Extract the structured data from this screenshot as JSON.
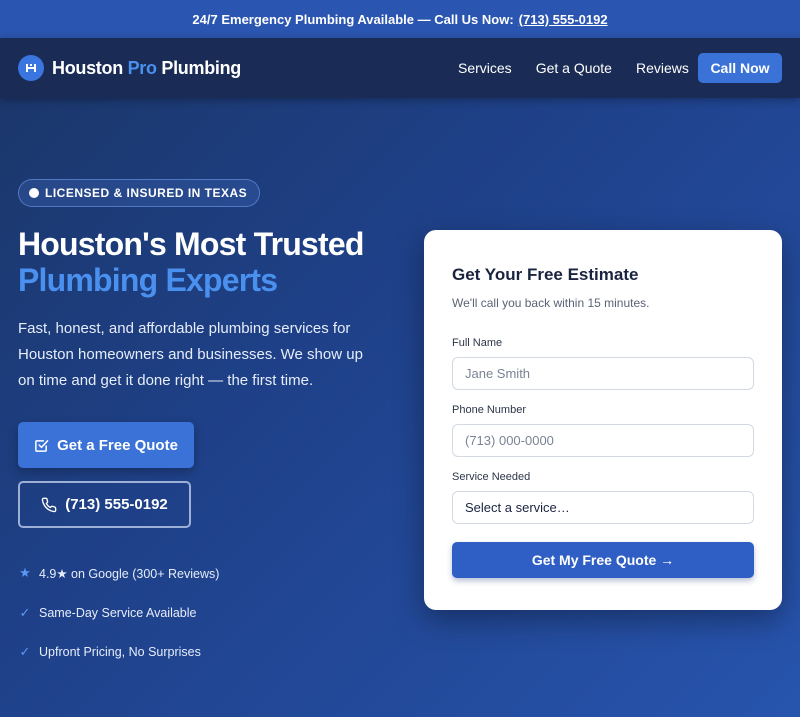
{
  "topbar": {
    "text": "24/7 Emergency Plumbing Available — Call Us Now:",
    "phone": "(713) 555-0192"
  },
  "brand": {
    "part1": "Houston ",
    "part2": "Pro",
    "part3": " Plumbing"
  },
  "nav": {
    "items": [
      "Services",
      "Get a Quote",
      "Reviews"
    ],
    "cta": "Call Now"
  },
  "hero": {
    "badge": "LICENSED & INSURED IN TEXAS",
    "headline_1": "Houston's Most Trusted",
    "headline_2": "Plumbing Experts",
    "lead": "Fast, honest, and affordable plumbing services for Houston homeowners and businesses. We show up on time and get it done right — the first time.",
    "btn_quote": "Get a Free Quote",
    "btn_phone": "(713) 555-0192",
    "features": [
      {
        "icon": "star-icon",
        "text": "4.9★ on Google (300+ Reviews)"
      },
      {
        "icon": "check-icon",
        "text": "Same-Day Service Available"
      },
      {
        "icon": "check-icon",
        "text": "Upfront Pricing, No Surprises"
      }
    ]
  },
  "form": {
    "title": "Get Your Free Estimate",
    "subtitle": "We'll call you back within 15 minutes.",
    "name_label": "Full Name",
    "name_placeholder": "Jane Smith",
    "phone_label": "Phone Number",
    "phone_placeholder": "(713) 000-0000",
    "service_label": "Service Needed",
    "service_selected": "Select a service…",
    "submit": "Get My Free Quote →"
  },
  "colors": {
    "accent": "#3a72d8",
    "brand_highlight": "#4a90ef",
    "nav_bg": "#1a2c55",
    "topbar_bg": "#2a55b0"
  }
}
